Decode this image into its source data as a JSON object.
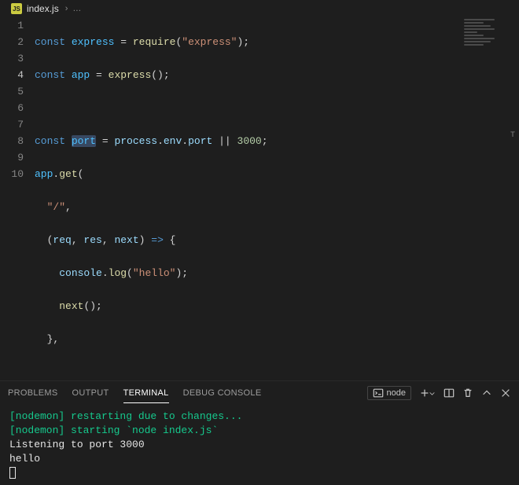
{
  "tab": {
    "icon_label": "JS",
    "filename": "index.js",
    "chevron": "›",
    "dots": "…"
  },
  "editor": {
    "lines": {
      "l1": {
        "t1": "const",
        "t2": " ",
        "t3": "express",
        "t4": " = ",
        "t5": "require",
        "t6": "(",
        "t7": "\"express\"",
        "t8": ");"
      },
      "l2": {
        "t1": "const",
        "t2": " ",
        "t3": "app",
        "t4": " = ",
        "t5": "express",
        "t6": "();"
      },
      "l3": {
        "t1": ""
      },
      "l4": {
        "t1": "const",
        "t2": " ",
        "t3": "port",
        "t4": " = ",
        "t5": "process",
        "t6": ".",
        "t7": "env",
        "t8": ".",
        "t9": "port",
        "t10": " || ",
        "t11": "3000",
        "t12": ";"
      },
      "l5": {
        "t1": "app",
        "t2": ".",
        "t3": "get",
        "t4": "("
      },
      "l6": {
        "t1": "  ",
        "t2": "\"/\"",
        "t3": ","
      },
      "l7": {
        "t1": "  (",
        "t2": "req",
        "t3": ", ",
        "t4": "res",
        "t5": ", ",
        "t6": "next",
        "t7": ") ",
        "t8": "=>",
        "t9": " {"
      },
      "l8": {
        "t1": "    ",
        "t2": "console",
        "t3": ".",
        "t4": "log",
        "t5": "(",
        "t6": "\"hello\"",
        "t7": ");"
      },
      "l9": {
        "t1": "    ",
        "t2": "next",
        "t3": "();"
      },
      "l10": {
        "t1": "  },"
      }
    },
    "line_numbers": [
      "1",
      "2",
      "3",
      "4",
      "5",
      "6",
      "7",
      "8",
      "9",
      "10"
    ]
  },
  "panel": {
    "tabs": {
      "problems": "PROBLEMS",
      "output": "OUTPUT",
      "terminal": "TERMINAL",
      "debug": "DEBUG CONSOLE"
    },
    "shell": {
      "label": "node"
    }
  },
  "terminal": {
    "l1": "[nodemon] restarting due to changes...",
    "l2": "[nodemon] starting `node index.js`",
    "l3": "Listening to port 3000",
    "l4": "hello"
  },
  "scroll_marks": {
    "m1": "T"
  }
}
